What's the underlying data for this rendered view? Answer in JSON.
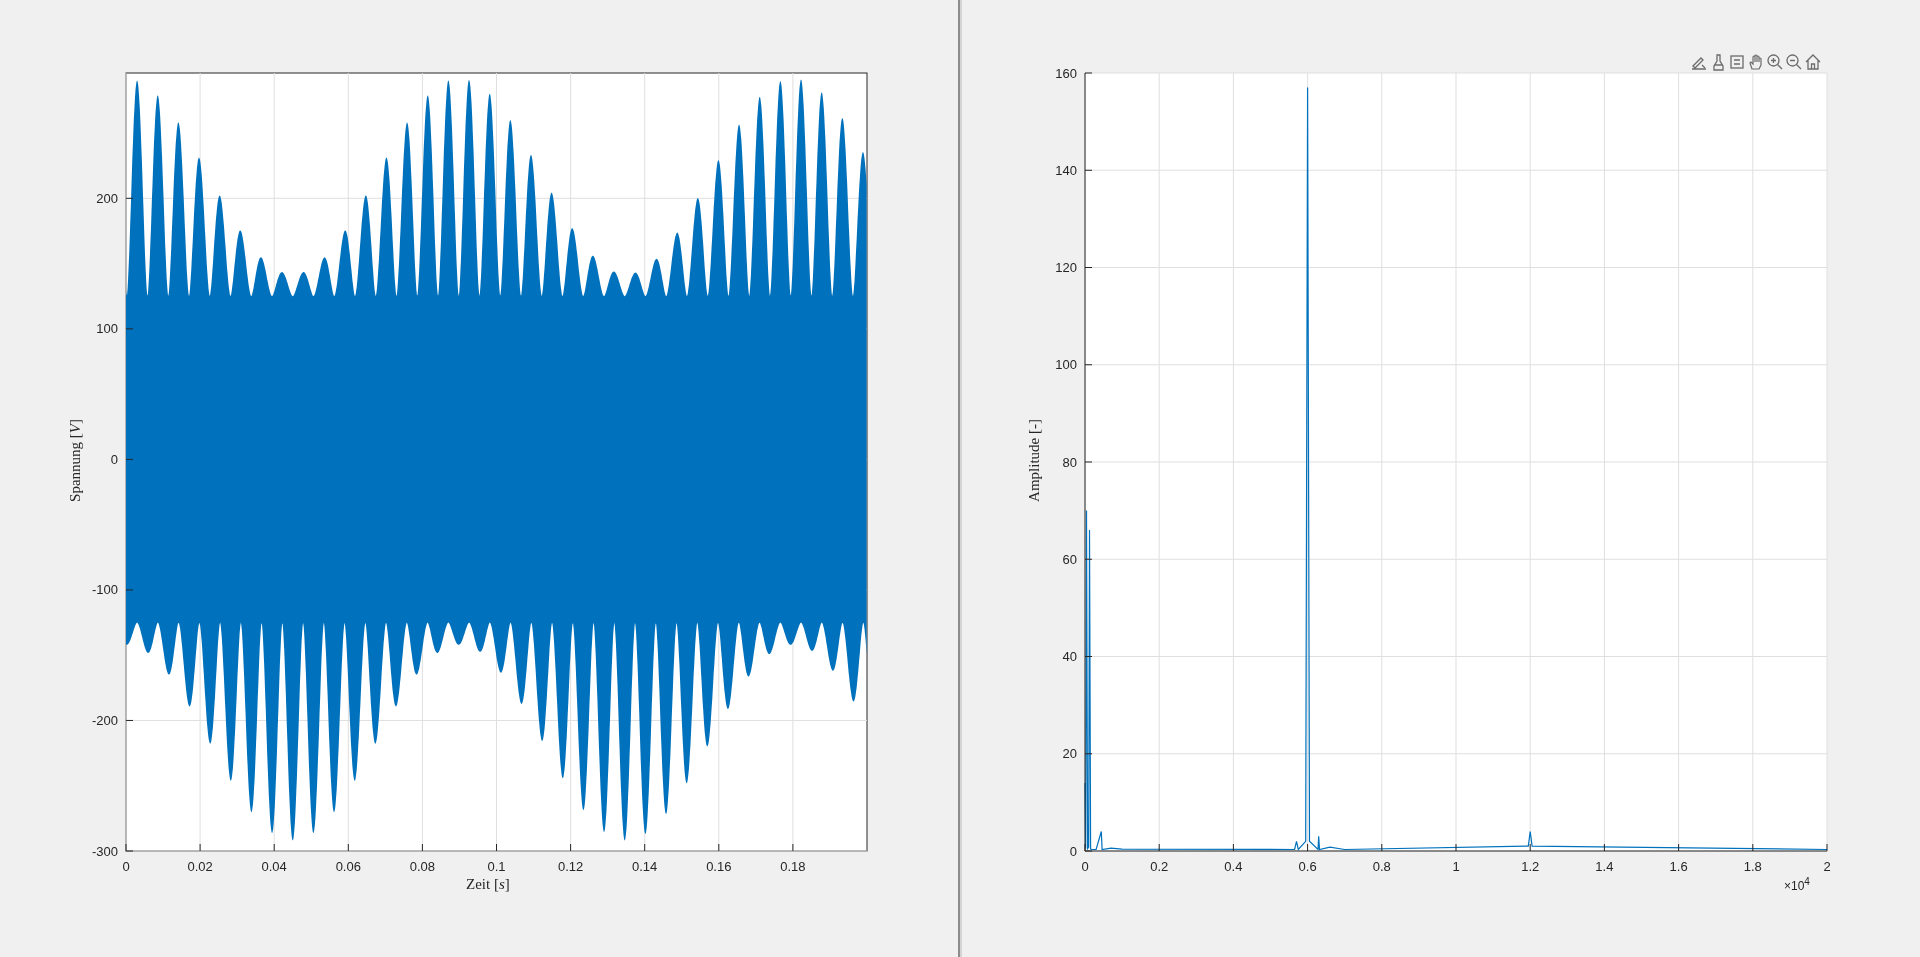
{
  "time_plot": {
    "xlabel": "Zeit [*s*]",
    "ylabel": "Spannung [*V*]",
    "xticks": [
      "0",
      "0.02",
      "0.04",
      "0.06",
      "0.08",
      "0.1",
      "0.12",
      "0.14",
      "0.16",
      "0.18"
    ],
    "yticks": [
      "200",
      "100",
      "0",
      "-100",
      "-200",
      "-300"
    ]
  },
  "spectrum_plot": {
    "axis_multiplier": "×10$^{4}$",
    "chart_data": {
      "type": "line",
      "grid": true,
      "ylabel": "Amplitude [-]",
      "xlim": [
        0,
        2
      ],
      "ylim": [
        0,
        160
      ],
      "xticks": [
        0,
        0.2,
        0.4,
        0.6,
        0.8,
        1,
        1.2,
        1.4,
        1.6,
        1.8,
        2
      ],
      "yticks": [
        0,
        20,
        40,
        60,
        80,
        100,
        120,
        140,
        160
      ],
      "x": [
        0,
        0.002,
        0.004,
        0.007,
        0.01,
        0.012,
        0.015,
        0.018,
        0.03,
        0.044,
        0.046,
        0.07,
        0.1,
        0.565,
        0.57,
        0.575,
        0.595,
        0.6,
        0.605,
        0.628,
        0.63,
        0.632,
        0.66,
        0.7,
        1.195,
        1.2,
        1.205,
        2
      ],
      "series": [
        {
          "color": "#0072bd",
          "values": [
            14,
            0.5,
            70,
            0.5,
            0.8,
            66,
            0.4,
            0.3,
            0.3,
            4,
            0.3,
            0.6,
            0.4,
            0.3,
            2,
            0.3,
            2,
            157,
            2,
            0.3,
            3,
            0.3,
            0.8,
            0.3,
            1,
            4,
            1,
            0.3
          ]
        }
      ]
    }
  }
}
